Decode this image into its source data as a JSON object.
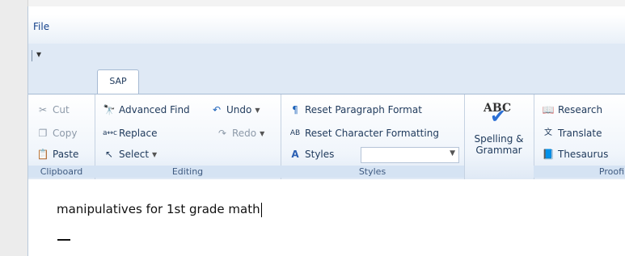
{
  "menu": {
    "file_label": "File"
  },
  "qat": {
    "customize_icon": "qat-dropdown-icon"
  },
  "tabs": [
    {
      "label": "SAP"
    }
  ],
  "ribbon": {
    "clipboard": {
      "label": "Clipboard",
      "cut": "Cut",
      "copy": "Copy",
      "paste": "Paste"
    },
    "editing": {
      "label": "Editing",
      "advanced_find": "Advanced Find",
      "replace": "Replace",
      "select": "Select",
      "undo": "Undo",
      "redo": "Redo"
    },
    "styles": {
      "label": "Styles",
      "reset_paragraph": "Reset Paragraph Format",
      "reset_character": "Reset Character Formatting",
      "styles_button": "Styles",
      "styles_combo_value": ""
    },
    "spelling": {
      "icon_text": "ABC",
      "line1": "Spelling &",
      "line2": "Grammar"
    },
    "proofing": {
      "label": "Proofi",
      "research": "Research",
      "translate": "Translate",
      "thesaurus": "Thesaurus"
    }
  },
  "document": {
    "text": "manipulatives for 1st grade math"
  }
}
